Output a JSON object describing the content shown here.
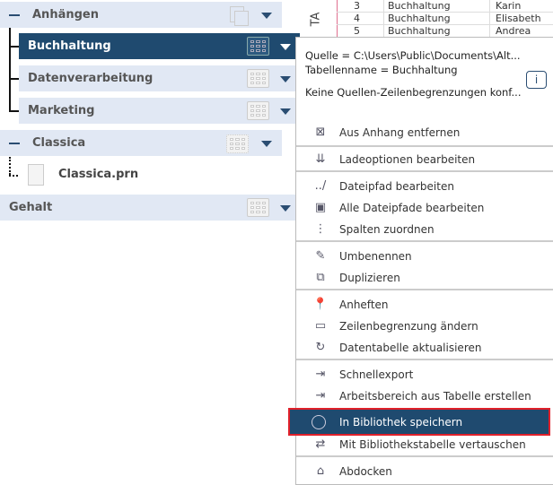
{
  "background_table": {
    "side_label": "TA",
    "rows": [
      [
        "3",
        "Buchhaltung",
        "Karin"
      ],
      [
        "4",
        "Buchhaltung",
        "Elisabeth"
      ],
      [
        "5",
        "Buchhaltung",
        "Andrea"
      ]
    ]
  },
  "tree": {
    "groups": [
      {
        "label": "Anhängen",
        "children": [
          "Buchhaltung",
          "Datenverarbeitung",
          "Marketing"
        ],
        "selected": "Buchhaltung"
      },
      {
        "label": "Classica",
        "children": [
          "Classica.prn"
        ]
      },
      {
        "label": "Gehalt"
      }
    ]
  },
  "info": {
    "source": "Quelle = C:\\Users\\Public\\Documents\\Alt...",
    "table_name": "Tabellenname = Buchhaltung",
    "row_limits": "Keine Quellen-Zeilenbegrenzungen konf...",
    "info_icon": "i"
  },
  "menu": {
    "items": [
      {
        "label": "Aus Anhang entfernen",
        "icon": "remove-from-append-icon"
      },
      {
        "label": "Ladeoptionen bearbeiten",
        "icon": "load-options-icon"
      },
      {
        "label": "Dateipfad bearbeiten",
        "icon": "file-path-icon"
      },
      {
        "label": "Alle Dateipfade bearbeiten",
        "icon": "all-file-paths-icon"
      },
      {
        "label": "Spalten zuordnen",
        "icon": "map-columns-icon"
      },
      {
        "label": "Umbenennen",
        "icon": "rename-icon"
      },
      {
        "label": "Duplizieren",
        "icon": "duplicate-icon"
      },
      {
        "label": "Anheften",
        "icon": "pin-icon"
      },
      {
        "label": "Zeilenbegrenzung ändern",
        "icon": "row-limit-icon"
      },
      {
        "label": "Datentabelle aktualisieren",
        "icon": "refresh-icon"
      },
      {
        "label": "Schnellexport",
        "icon": "export-icon"
      },
      {
        "label": "Arbeitsbereich aus Tabelle erstellen",
        "icon": "create-workspace-icon"
      },
      {
        "label": "In Bibliothek speichern",
        "icon": "save-library-icon",
        "highlighted": true
      },
      {
        "label": "Mit Bibliothekstabelle vertauschen",
        "icon": "swap-library-icon"
      },
      {
        "label": "Abdocken",
        "icon": "undock-icon"
      }
    ]
  },
  "colors": {
    "selected": "#1f4a6f",
    "header": "#e1e8f4",
    "highlight_border": "#e0202a"
  }
}
